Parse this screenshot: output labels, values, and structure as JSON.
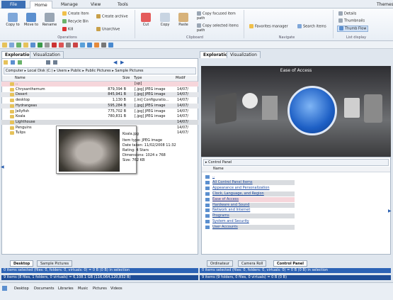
{
  "tabs": {
    "file": "File",
    "home": "Home",
    "manage": "Manage",
    "view": "View",
    "tools": "Tools",
    "themes": "Themes"
  },
  "ribbon": {
    "copy_to": "Copy to",
    "move_to": "Move to",
    "rename": "Rename",
    "create_item": "Create Item",
    "recycle_bin": "Recycle Bin",
    "kill": "Kill",
    "create_archive": "Create archive",
    "unarchive": "Unarchive",
    "operations_group": "Operations",
    "cut": "Cut",
    "copy": "Copy",
    "paste": "Paste",
    "copy_focused": "Copy focused item path",
    "copy_selected": "Copy selected items path",
    "clipboard_group": "Clipboard",
    "favorites_manager": "Favorites manager",
    "search_items": "Search items",
    "navigate_group": "Navigate",
    "details": "Details",
    "thumbnails": "Thumbnails",
    "thumb_flow": "Thumb Flow",
    "list_display_group": "List display"
  },
  "left_panel": {
    "tabs": [
      "Exploration",
      "Visualization"
    ],
    "breadcrumb": [
      "Computer",
      "Local Disk (C:)",
      "Users",
      "Public",
      "Public Pictures",
      "Sample Pictures"
    ],
    "columns": {
      "name": "Name",
      "size": "Size",
      "type": "Type",
      "modified": "Modif"
    },
    "rows": [
      {
        "name": "..",
        "size": "",
        "type": "[up]",
        "date": ""
      },
      {
        "name": "Chrysanthemum",
        "size": "879,394 B",
        "type": "[.jpg] JPEG image",
        "date": "14/07/"
      },
      {
        "name": "Desert",
        "size": "845,941 B",
        "type": "[.jpg] JPEG image",
        "date": "14/07/"
      },
      {
        "name": "desktop",
        "size": "1,130 B",
        "type": "[.ini] Configuratio...",
        "date": "14/07/"
      },
      {
        "name": "Hydrangeas",
        "size": "595,284 B",
        "type": "[.jpg] JPEG image",
        "date": "14/07/"
      },
      {
        "name": "Jellyfish",
        "size": "775,702 B",
        "type": "[.jpg] JPEG image",
        "date": "14/07/"
      },
      {
        "name": "Koala",
        "size": "780,831 B",
        "type": "[.jpg] JPEG image",
        "date": "14/07/"
      },
      {
        "name": "Lighthouse",
        "size": "",
        "type": "",
        "date": "14/07/"
      },
      {
        "name": "Penguins",
        "size": "",
        "type": "",
        "date": "14/07/"
      },
      {
        "name": "Tulips",
        "size": "",
        "type": "",
        "date": "14/07/"
      }
    ],
    "tooltip": {
      "title": "Koala.jpg",
      "type": "Item type: JPEG image",
      "date": "Date taken: 11/02/2008 11:32",
      "rating": "Rating: 4 Stars",
      "dims": "Dimensions: 1024 x 768",
      "size": "Size: 762 KB"
    },
    "bottom_tabs": [
      "Desktop",
      "Sample Pictures"
    ],
    "status1": "0 items selected (files: 0, folders: 0, virtuals: 0) = 0 B (0 B) in selection",
    "status2": "9 items (8 files, 1 folders, 0 virtuals) = 6,108.1 GB (116,064,120,832 B)"
  },
  "right_panel": {
    "tabs": [
      "Exploration",
      "Visualization"
    ],
    "preview_title": "Ease of Access",
    "breadcrumb": [
      "Control Panel"
    ],
    "columns": {
      "name": "Name"
    },
    "items": [
      "..",
      "All Control Panel Items",
      "Appearance and Personalization",
      "Clock, Language, and Region",
      "Ease of Access",
      "Hardware and Sound",
      "Network and Internet",
      "Programs",
      "System and Security",
      "User Accounts"
    ],
    "bottom_tabs": [
      "Ordinateur",
      "Camera Roll",
      "Control Panel"
    ],
    "status1": "0 items selected (files: 0, folders: 0, virtuals: 0) = 0 B (0 B) in selection",
    "status2": "9 items (9 folders, 0 files, 0 virtuals) = 0 B (0 B)"
  },
  "bottom_bar": [
    "Desktop",
    "Documents",
    "Libraries",
    "Music",
    "Pictures",
    "Videos"
  ]
}
